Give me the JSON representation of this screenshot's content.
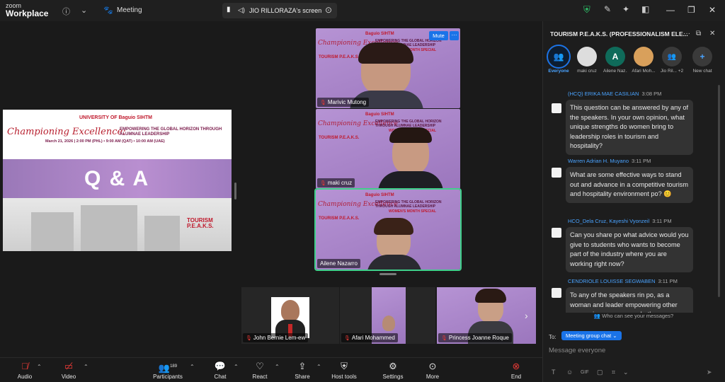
{
  "titlebar": {
    "brand_top": "zoom",
    "brand_bottom": "Workplace",
    "meeting_label": "Meeting",
    "screen_tab": "JIO RILLORAZA's screen"
  },
  "slide": {
    "logos": "UNIVERSITY OF Baguio  SIHTM",
    "title": "Championing Excellence:",
    "subtitle": "EMPOWERING THE GLOBAL HORIZON THROUGH ALUMNAE LEADERSHIP",
    "date": "March 21, 2026 | 2:00 PM (PHL) • 9:00 AM (QAT) • 10:00 AM (UAE)",
    "band": "Q & A",
    "footer_top": "TOURISM",
    "footer_bottom": "P.E.A.K.S."
  },
  "gallery": {
    "logo": "Baguio  SIHTM",
    "title": "Championing Excellence",
    "subtitle": "EMPOWERING THE GLOBAL HORIZON THROUGH ALUMNAE LEADERSHIP",
    "watermark": "WOMEN'S MONTH SPECIAL",
    "tp": "TOURISM P.E.A.K.S.",
    "mute": "Mute",
    "more": "···",
    "tiles": [
      {
        "name": "Marivic Mutong"
      },
      {
        "name": "maki cruz"
      },
      {
        "name": "Ailene Nazarro"
      }
    ]
  },
  "strip": [
    {
      "name": "John Bernie Lem-ew"
    },
    {
      "name": "Afari Mohammed"
    },
    {
      "name": "Princess Joanne Roque"
    }
  ],
  "toolbar": {
    "audio": "Audio",
    "video": "Video",
    "participants": "Participants",
    "participants_count": "189",
    "chat": "Chat",
    "react": "React",
    "share": "Share",
    "host_tools": "Host tools",
    "settings": "Settings",
    "more": "More",
    "end": "End"
  },
  "chat": {
    "title": "TOURISM P.E.A.K.S. (PROFESSIONALISM ELE...",
    "avatars": [
      {
        "label": "Everyone",
        "glyph": "👥"
      },
      {
        "label": "maki cruz",
        "glyph": ""
      },
      {
        "label": "Ailene Naz...",
        "glyph": "A"
      },
      {
        "label": "Afari Moh...",
        "glyph": ""
      },
      {
        "label": "Jio Ril... +2",
        "glyph": "👥"
      },
      {
        "label": "New chat",
        "glyph": "+"
      }
    ],
    "messages": [
      {
        "sender": "(HCQ) ERIKA MAE CASILIAN",
        "time": "3:08 PM",
        "text": "This question can be answered by any of the speakers. In your own opinion, what unique strengths do women bring to leadership roles in tourism and hospitality?"
      },
      {
        "sender": "Warren Adrian H. Muyano",
        "time": "3:11 PM",
        "text": "What are some effective ways to stand out and advance in a competitive tourism and hospitality environment po? 😊"
      },
      {
        "sender": "HCO_Dela Cruz, Kayeshi Vyonzeil",
        "time": "3:11 PM",
        "text": "Can you share po what advice would you give to students who wants to become part of the industry where you are working right now?"
      },
      {
        "sender": "CENDRIOLE LOUISSE SEGWABEN",
        "time": "3:11 PM",
        "text": "To any of the speakers rin po, as a woman and leader empowering other women in your career, what's"
      }
    ],
    "who_can_see": "Who can see your messages?",
    "to_label": "To:",
    "to_value": "Meeting group chat ⌄",
    "placeholder": "Message everyone"
  }
}
